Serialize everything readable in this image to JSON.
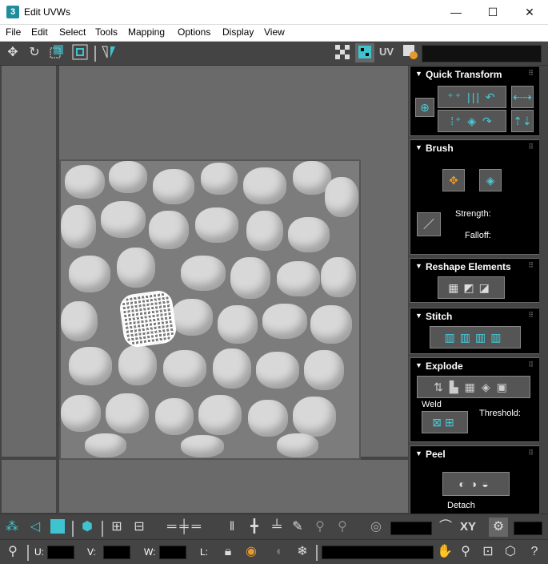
{
  "window": {
    "app_icon": "3",
    "title": "Edit UVWs",
    "minimize": "—",
    "maximize": "☐",
    "close": "✕"
  },
  "menu": [
    "File",
    "Edit",
    "Select",
    "Tools",
    "Mapping",
    "Options",
    "Display",
    "View"
  ],
  "top_toolbar": {
    "uv_label": "UV",
    "icons": [
      "move-icon",
      "rotate-icon",
      "scale-icon",
      "freeform-icon",
      "mirror-icon",
      "checker-icon",
      "texture-map-icon",
      "uv-display-icon",
      "settings-icon"
    ]
  },
  "rollouts": {
    "quick_transform": {
      "title": "Quick Transform"
    },
    "brush": {
      "title": "Brush",
      "strength_label": "Strength:",
      "falloff_label": "Falloff:"
    },
    "reshape": {
      "title": "Reshape Elements"
    },
    "stitch": {
      "title": "Stitch"
    },
    "explode": {
      "title": "Explode",
      "weld_label": "Weld",
      "threshold_label": "Threshold:"
    },
    "peel": {
      "title": "Peel",
      "detach_label": "Detach"
    }
  },
  "bottom_toolbar": {
    "xy_label": "XY",
    "u_label": "U:",
    "v_label": "V:",
    "w_label": "W:",
    "l_label": "L:"
  },
  "colors": {
    "accent": "#3ec3cf",
    "panel_bg": "#444444",
    "rollout_bg": "#000000",
    "viewport_bg": "#6a6a6a"
  }
}
